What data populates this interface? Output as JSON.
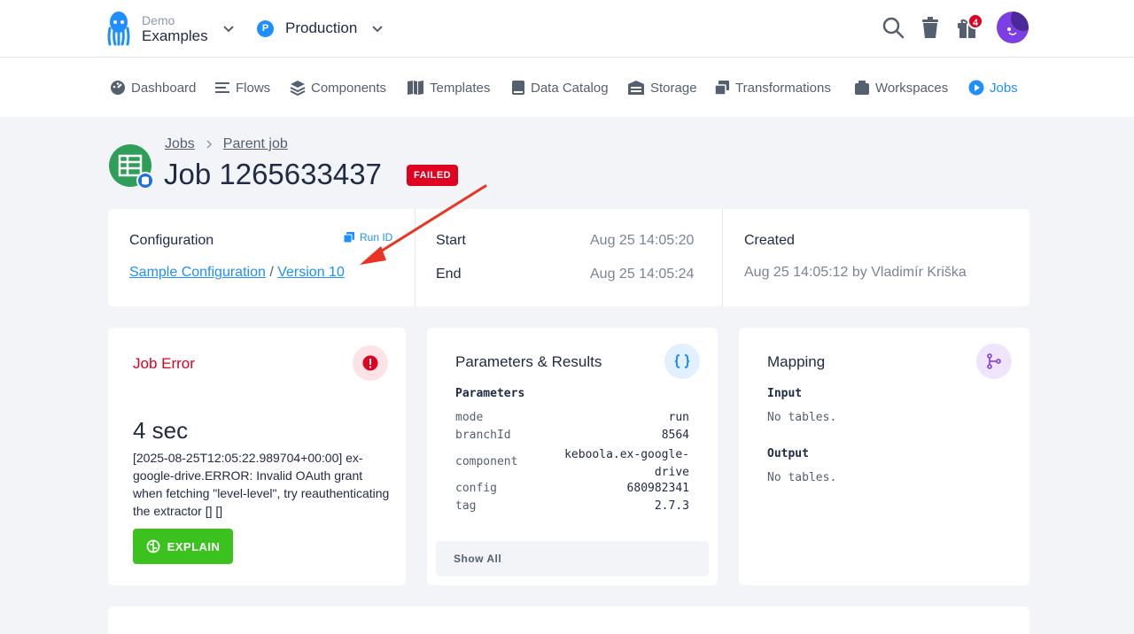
{
  "header": {
    "project_small": "Demo",
    "project_big": "Examples",
    "branch_badge": "P",
    "branch_name": "Production",
    "notifications": "4",
    "colors": {
      "accent": "#1f8fff",
      "danger": "#e00020",
      "success": "#3cc21f"
    }
  },
  "nav": {
    "items": [
      {
        "label": "Dashboard",
        "icon": "dashboard-icon"
      },
      {
        "label": "Flows",
        "icon": "flows-icon"
      },
      {
        "label": "Components",
        "icon": "components-icon"
      },
      {
        "label": "Templates",
        "icon": "templates-icon"
      },
      {
        "label": "Data Catalog",
        "icon": "data-catalog-icon"
      },
      {
        "label": "Storage",
        "icon": "storage-icon"
      },
      {
        "label": "Transformations",
        "icon": "transformations-icon"
      },
      {
        "label": "Workspaces",
        "icon": "workspaces-icon"
      },
      {
        "label": "Jobs",
        "icon": "jobs-icon",
        "active": true
      }
    ]
  },
  "page": {
    "breadcrumbs": [
      "Jobs",
      "Parent job"
    ],
    "title": "Job 1265633437",
    "status": "FAILED"
  },
  "info": {
    "configuration_label": "Configuration",
    "run_id_label": "Run ID",
    "config_name": "Sample Configuration",
    "separator": "/",
    "version": "Version 10",
    "start_label": "Start",
    "start_value": "Aug 25 14:05:20",
    "end_label": "End",
    "end_value": "Aug 25 14:05:24",
    "created_label": "Created",
    "created_value": "Aug 25 14:05:12 by Vladimír Kriška"
  },
  "job_error": {
    "title": "Job Error",
    "duration": "4 sec",
    "message": "[2025-08-25T12:05:22.989704+00:00] ex-google-drive.ERROR: Invalid OAuth grant when fetching \"level-level\", try reauthenticating the extractor [] []",
    "explain_label": "EXPLAIN"
  },
  "params": {
    "title": "Parameters & Results",
    "section": "Parameters",
    "rows": [
      {
        "key": "mode",
        "value": "run"
      },
      {
        "key": "branchId",
        "value": "8564"
      },
      {
        "key": "component",
        "value": "keboola.ex-google-drive"
      },
      {
        "key": "config",
        "value": "680982341"
      },
      {
        "key": "tag",
        "value": "2.7.3"
      }
    ],
    "show_all": "Show All"
  },
  "mapping": {
    "title": "Mapping",
    "input_label": "Input",
    "input_value": "No tables.",
    "output_label": "Output",
    "output_value": "No tables."
  }
}
